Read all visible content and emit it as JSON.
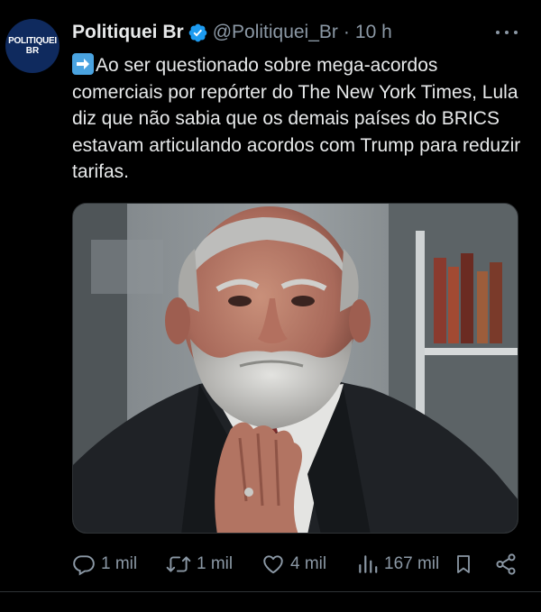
{
  "avatar": {
    "line1": "POLITIQUEI",
    "line2": "BR"
  },
  "author": {
    "name": "Politiquei Br",
    "handle": "@Politiquei_Br",
    "separator": "·",
    "time": "10 h"
  },
  "tweet": {
    "emoji_icon": "right-arrow-emoji-icon",
    "text": "Ao ser questionado sobre mega-acordos comerciais por repórter do The New York Times, Lula diz que não sabia que os demais países do BRICS estavam articulando acordos com Trump para reduzir tarifas."
  },
  "actions": {
    "replies": "1 mil",
    "reposts": "1 mil",
    "likes": "4 mil",
    "views": "167 mil"
  },
  "colors": {
    "background": "#000000",
    "text": "#e7e9ea",
    "muted": "#8b98a5",
    "verified": "#1d9bf0",
    "avatar_bg": "#0f2a5e"
  }
}
